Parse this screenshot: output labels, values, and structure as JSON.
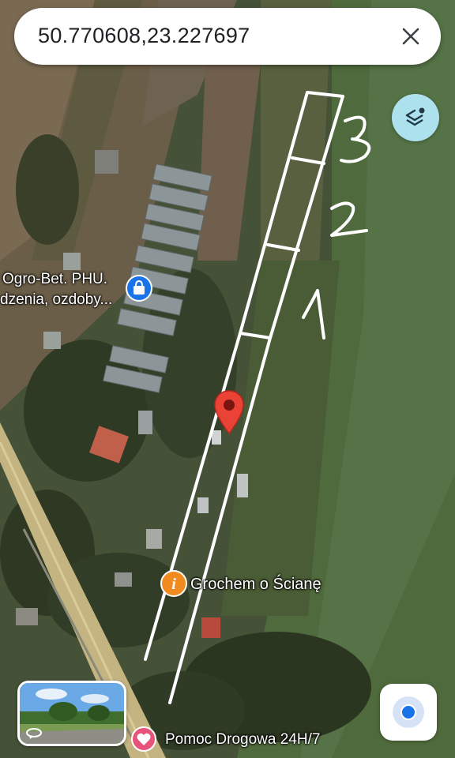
{
  "search": {
    "query": "50.770608,23.227697"
  },
  "icons": {
    "close": "close-icon",
    "layers": "layers-icon",
    "pin": "map-pin-icon",
    "shop": "shopping-bag-icon",
    "info": "info-icon",
    "heart": "heart-icon",
    "location": "my-location-icon",
    "rotate": "rotate-360-icon"
  },
  "pois": {
    "ogro_bet_line1": "Ogro-Bet. PHU.",
    "ogro_bet_line2": "dzenia, ozdoby...",
    "grochem": "Grochem o Ścianę",
    "pomoc": "Pomoc Drogowa 24H/7"
  },
  "annotations": {
    "numbers": [
      "1",
      "2",
      "3"
    ]
  },
  "colors": {
    "pin_red": "#ea4335",
    "poi_blue": "#1a73e8",
    "poi_orange": "#f28b1f",
    "poi_pink": "#e8537a",
    "layers_bg": "#aee1ee"
  }
}
